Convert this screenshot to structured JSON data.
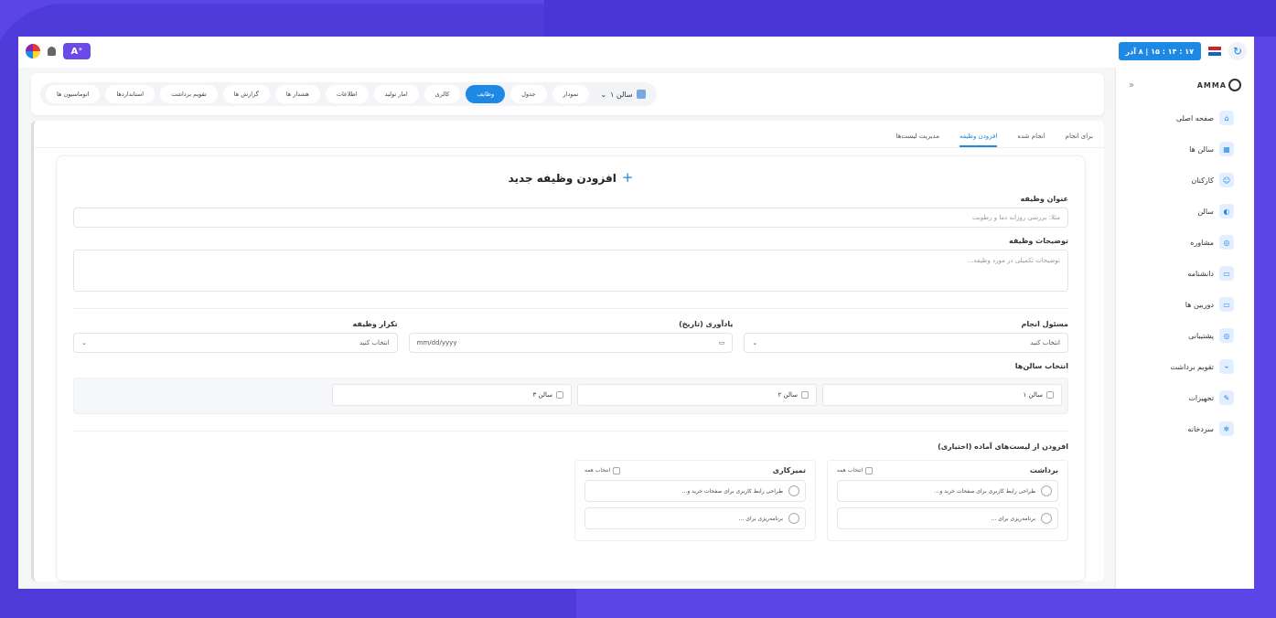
{
  "topbar": {
    "ai_label": "A⁺",
    "clock": "۱۷ : ۱۴ : ۱۵ | ۸ آذر",
    "refresh_glyph": "↻"
  },
  "sidebar": {
    "brand": "AMMA",
    "collapse": "«",
    "items": [
      {
        "label": "صفحه اصلی",
        "icon": "⌂"
      },
      {
        "label": "سالن ها",
        "icon": "▦"
      },
      {
        "label": "کارکنان",
        "icon": "☺"
      },
      {
        "label": "سالن",
        "icon": "◐"
      },
      {
        "label": "مشاوره",
        "icon": "◎"
      },
      {
        "label": "دانشنامه",
        "icon": "▭"
      },
      {
        "label": "دوربین ها",
        "icon": "▭"
      },
      {
        "label": "پشتیبانی",
        "icon": "◎"
      },
      {
        "label": "تقویم برداشت",
        "icon": "⌁"
      },
      {
        "label": "تجهیزات",
        "icon": "✎"
      },
      {
        "label": "سردخانه",
        "icon": "❄"
      }
    ]
  },
  "navbar": {
    "hall_selector": "سالن ۱",
    "chevron": "⌄",
    "items": [
      {
        "label": "نمودار",
        "active": false
      },
      {
        "label": "جدول",
        "active": false
      },
      {
        "label": "وظایف",
        "active": true
      },
      {
        "label": "کالری",
        "active": false
      },
      {
        "label": "امار تولید",
        "active": false
      },
      {
        "label": "اطلاعات",
        "active": false
      },
      {
        "label": "هشدار ها",
        "active": false
      },
      {
        "label": "گزارش ها",
        "active": false
      },
      {
        "label": "تقویم برداشت",
        "active": false
      },
      {
        "label": "استانداردها",
        "active": false
      },
      {
        "label": "اتوماسیون ها",
        "active": false
      }
    ]
  },
  "tabs": [
    {
      "label": "برای انجام",
      "active": false
    },
    {
      "label": "انجام شده",
      "active": false
    },
    {
      "label": "افزودن وظیفه",
      "active": true
    },
    {
      "label": "مدیریت لیست‌ها",
      "active": false
    }
  ],
  "form": {
    "title": "افزودن وظیفه جدید",
    "plus": "+",
    "task_title_label": "عنوان وظیفه",
    "task_title_placeholder": "مثلا: بررسی روزانه دما و رطوبت",
    "desc_label": "توضیحات وظیفه",
    "desc_placeholder": "توضیحات تکمیلی در مورد وظیفه...",
    "responsible_label": "مسئول انجام",
    "responsible_value": "انتخاب کنید",
    "reminder_label": "یادآوری (تاریخ)",
    "reminder_value": "mm/dd/yyyy",
    "repeat_label": "تکرار وظیفه",
    "repeat_value": "انتخاب کنید",
    "halls_label": "انتخاب سالن‌ها",
    "halls": [
      "سالن ۱",
      "سالن ۲",
      "سالن ۳"
    ],
    "lists_label": "افزودن از لیست‌های آماده (اختیاری)",
    "select_all": "انتخاب همه",
    "lists": [
      {
        "title": "برداشت",
        "items": [
          "طراحی رابط کاربری برای صفحات خرید و...",
          "برنامه‌ریزی برای ..."
        ]
      },
      {
        "title": "تمیزکاری",
        "items": [
          "طراحی رابط کاربری برای صفحات خرید و...",
          "برنامه‌ریزی برای ..."
        ]
      }
    ]
  }
}
